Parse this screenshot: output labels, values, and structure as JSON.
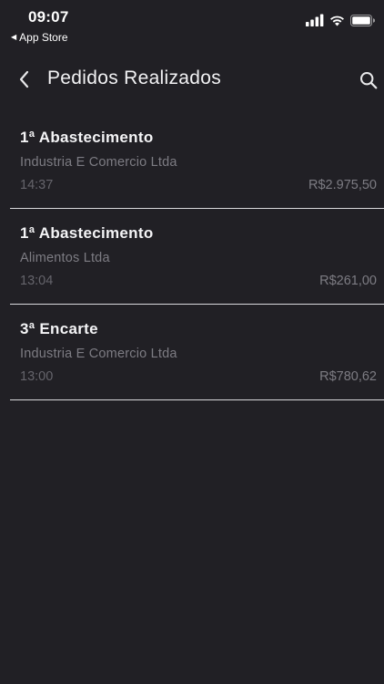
{
  "status_bar": {
    "time": "09:07",
    "back_app_label": "App Store",
    "back_arrow": "◀"
  },
  "nav": {
    "title": "Pedidos Realizados",
    "back_icon": "chevron-left-icon",
    "search_icon": "search-icon"
  },
  "orders": [
    {
      "title": "1ª Abastecimento",
      "company": "Industria E Comercio Ltda",
      "time": "14:37",
      "value": "R$2.975,50"
    },
    {
      "title": "1ª Abastecimento",
      "company": "Alimentos Ltda",
      "time": "13:04",
      "value": "R$261,00"
    },
    {
      "title": "3ª Encarte",
      "company": "Industria E Comercio Ltda",
      "time": "13:00",
      "value": "R$780,62"
    }
  ],
  "colors": {
    "background": "#212025",
    "title_text": "#f4f4f6",
    "secondary_text": "#7d7c83",
    "divider": "#d9d9dc"
  }
}
